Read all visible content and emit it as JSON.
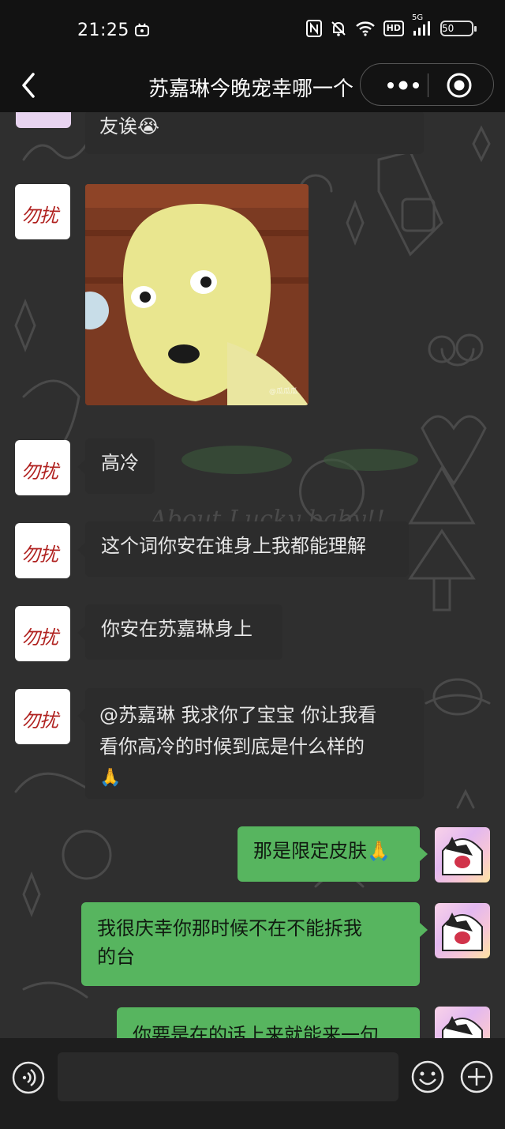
{
  "status_bar": {
    "time": "21:25",
    "network": "5G",
    "hd_label": "HD",
    "battery": "50",
    "icons": [
      "nfc-icon",
      "mute-icon",
      "wifi-icon",
      "hd-icon",
      "signal-icon",
      "battery-icon"
    ]
  },
  "nav": {
    "title": "苏嘉琳今晚宠幸哪一个",
    "back_icon": "chevron-left-icon",
    "more_icon": "more-dots-icon",
    "close_icon": "target-close-icon"
  },
  "messages": [
    {
      "side": "left",
      "type": "text",
      "text": "友诶😭"
    },
    {
      "side": "left",
      "type": "sticker",
      "watermark": "@瓜瓜瓜"
    },
    {
      "side": "left",
      "type": "text",
      "text": "高冷"
    },
    {
      "side": "left",
      "type": "text",
      "text": "这个词你安在谁身上我都能理解"
    },
    {
      "side": "left",
      "type": "text",
      "text": "你安在苏嘉琳身上"
    },
    {
      "side": "left",
      "type": "text",
      "lines": [
        "@苏嘉琳 我求你了宝宝 你让我看",
        "看你高冷的时候到底是什么样的",
        "🙏"
      ]
    },
    {
      "side": "right",
      "type": "text",
      "text": "那是限定皮肤🙏"
    },
    {
      "side": "right",
      "type": "text",
      "lines": [
        "我很庆幸你那时候不在不能拆我",
        "的台"
      ]
    },
    {
      "side": "right",
      "type": "text",
      "text": "你要是在的话上来就能来一句"
    }
  ],
  "avatar_left_text": "勿扰",
  "wallpaper_text": "About Lucky baby!!",
  "input_bar": {
    "placeholder": "",
    "voice_icon": "voice-icon",
    "emoji_icon": "emoji-smile-icon",
    "plus_icon": "plus-circle-icon"
  },
  "colors": {
    "bubble_left": "#2c2c2c",
    "bubble_right": "#57b55f",
    "background": "#121212"
  }
}
